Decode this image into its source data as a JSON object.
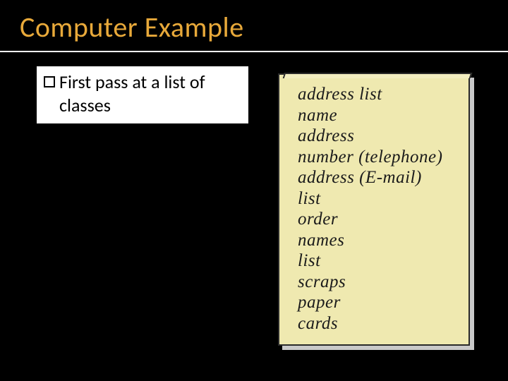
{
  "title": "Computer Example",
  "bullet": {
    "text": "First pass at a list of classes"
  },
  "note": {
    "items": [
      "address list",
      "name",
      "address",
      "number (telephone)",
      "address (E-mail)",
      "list",
      "order",
      "names",
      "list",
      "scraps",
      "paper",
      "cards"
    ]
  }
}
